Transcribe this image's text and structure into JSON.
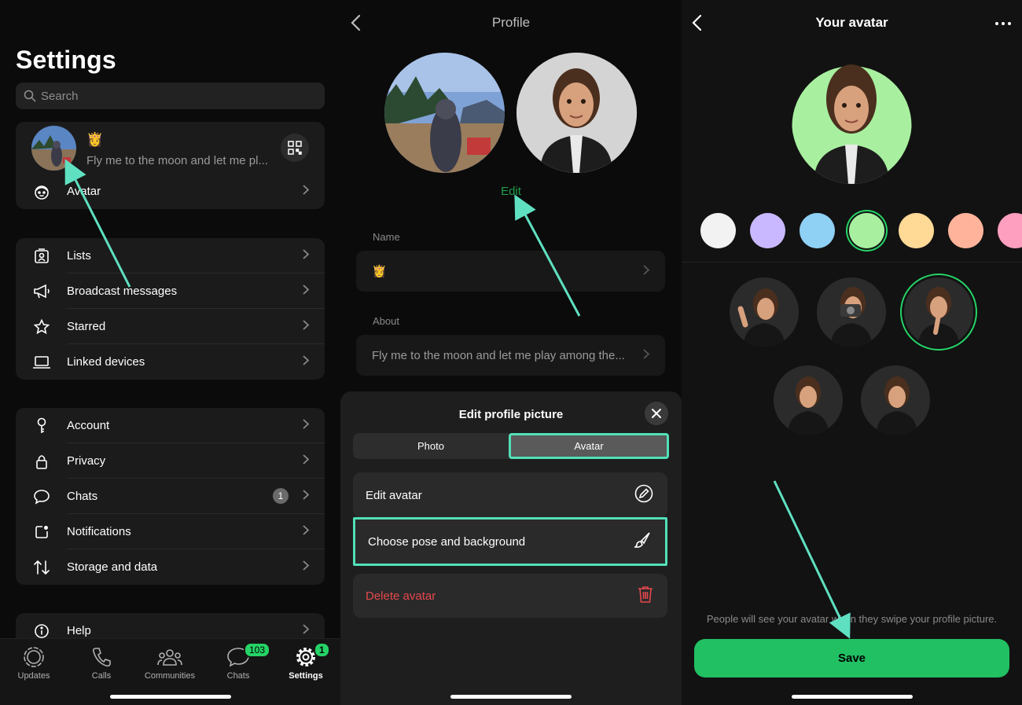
{
  "settings": {
    "title": "Settings",
    "search_placeholder": "Search",
    "profile": {
      "emoji": "👸",
      "status": "Fly me to the moon and let me pl..."
    },
    "avatar_label": "Avatar",
    "group1": [
      "Lists",
      "Broadcast messages",
      "Starred",
      "Linked devices"
    ],
    "group2": [
      "Account",
      "Privacy",
      "Chats",
      "Notifications",
      "Storage and data"
    ],
    "chats_badge": "1",
    "help_label": "Help",
    "tabs": [
      {
        "label": "Updates",
        "icon": "updates-icon"
      },
      {
        "label": "Calls",
        "icon": "phone-icon"
      },
      {
        "label": "Communities",
        "icon": "communities-icon"
      },
      {
        "label": "Chats",
        "icon": "chat-bubble-icon",
        "badge": "103"
      },
      {
        "label": "Settings",
        "icon": "gear-icon",
        "badge": "1"
      }
    ]
  },
  "profile": {
    "title": "Profile",
    "edit_label": "Edit",
    "name_label": "Name",
    "name_value": "👸",
    "about_label": "About",
    "about_value": "Fly me to the moon and let me play among the...",
    "sheet": {
      "title": "Edit profile picture",
      "tab_photo": "Photo",
      "tab_avatar": "Avatar",
      "edit_avatar": "Edit avatar",
      "choose_pose": "Choose pose and background",
      "delete_avatar": "Delete avatar"
    }
  },
  "your_avatar": {
    "title": "Your avatar",
    "swatches": [
      "#f2f2f2",
      "#c9b8ff",
      "#8fd0f5",
      "#a8f0a0",
      "#ffd996",
      "#ffb39a",
      "#ff9fc0"
    ],
    "selected_swatch": 3,
    "hint": "People will see your avatar when they swipe your profile picture.",
    "save_label": "Save"
  },
  "colors": {
    "accent": "#25d366",
    "highlight": "#52e0b8",
    "danger": "#e5484d"
  }
}
